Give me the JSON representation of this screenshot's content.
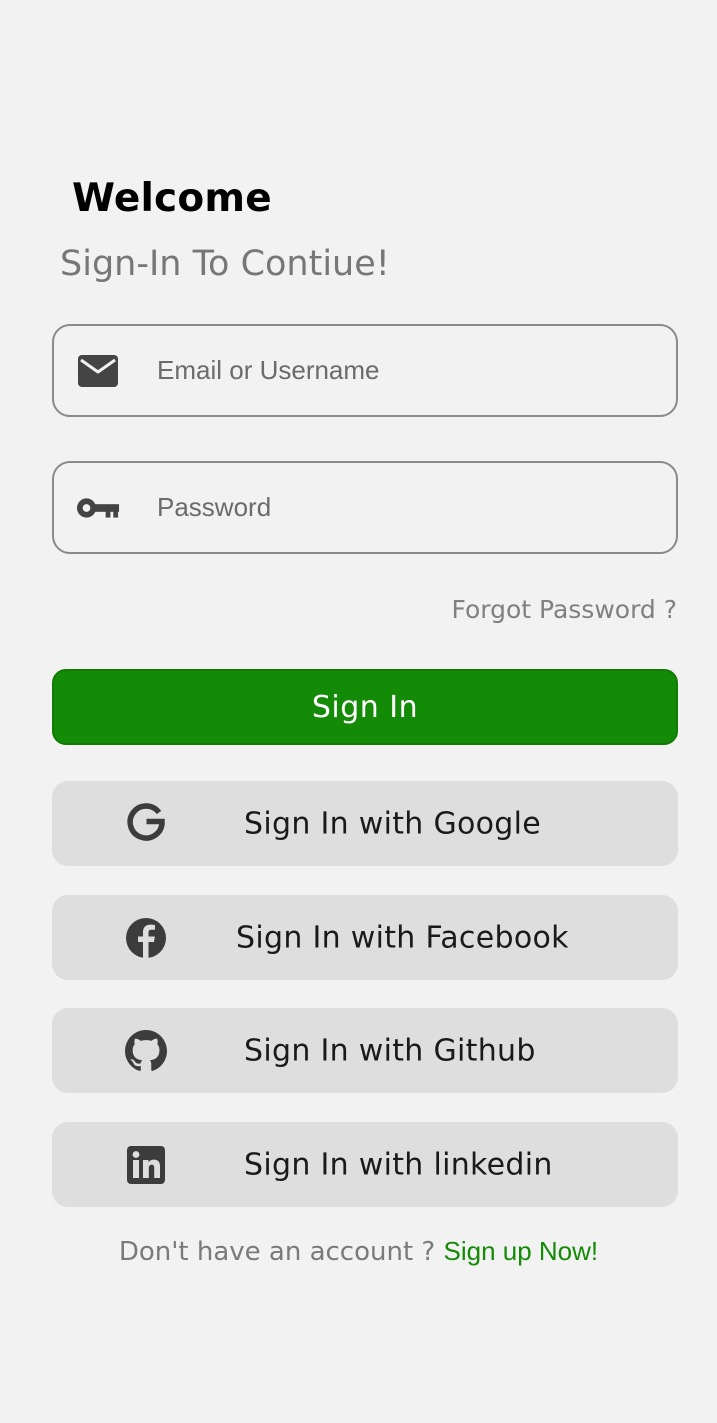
{
  "header": {
    "title": "Welcome",
    "subtitle": "Sign-In To Contiue!"
  },
  "form": {
    "email": {
      "placeholder": "Email or Username",
      "value": "",
      "icon": "mail-icon"
    },
    "password": {
      "placeholder": "Password",
      "value": "",
      "icon": "key-icon"
    },
    "forgot_label": "Forgot Password ?",
    "signin_label": "Sign In"
  },
  "social": [
    {
      "label": "Sign In with Google",
      "icon": "google-icon"
    },
    {
      "label": "Sign In with Facebook",
      "icon": "facebook-icon"
    },
    {
      "label": "Sign In with Github",
      "icon": "github-icon"
    },
    {
      "label": "Sign In with linkedin",
      "icon": "linkedin-icon"
    }
  ],
  "footer": {
    "prompt": "Don't have an account ? ",
    "signup_label": "Sign up Now!"
  },
  "colors": {
    "background": "#f2f2f2",
    "primary": "#148b07",
    "social_button": "#dedede",
    "icon": "#3c3c3c"
  }
}
